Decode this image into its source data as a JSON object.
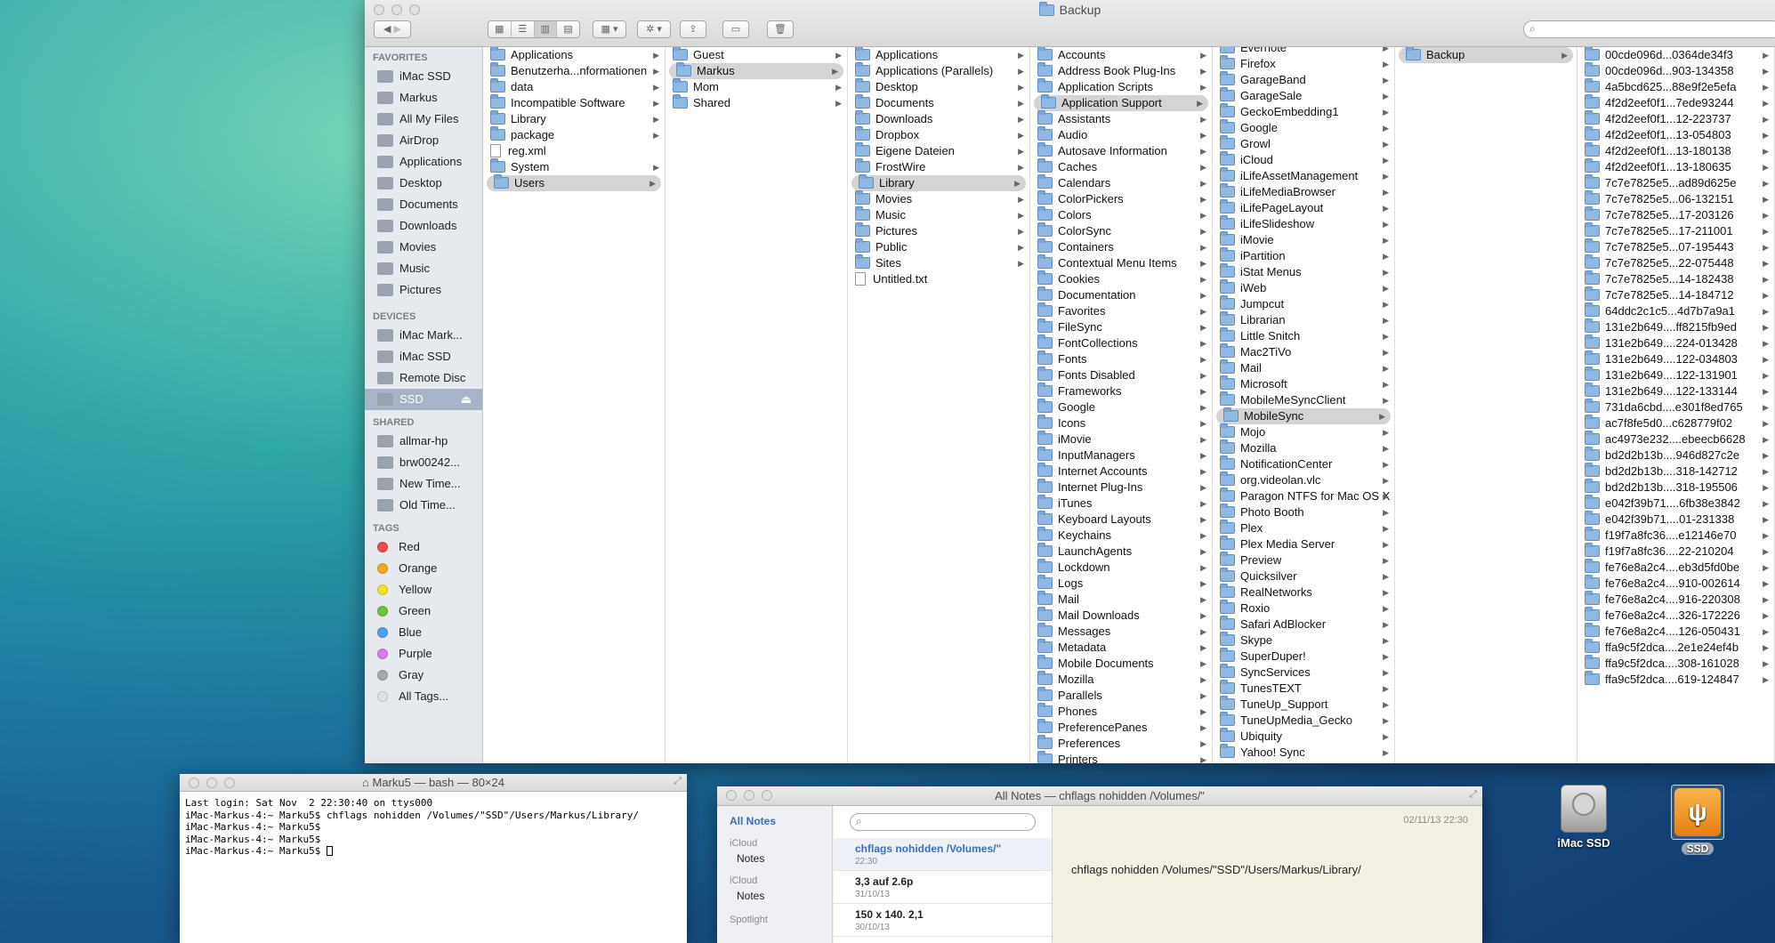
{
  "finder": {
    "title": "Backup",
    "sidebar": {
      "favorites_header": "FAVORITES",
      "favorites": [
        {
          "label": "iMac SSD",
          "icon": "hard-drive-icon"
        },
        {
          "label": "Markus",
          "icon": "home-icon"
        },
        {
          "label": "All My Files",
          "icon": "all-files-icon"
        },
        {
          "label": "AirDrop",
          "icon": "airdrop-icon"
        },
        {
          "label": "Applications",
          "icon": "applications-icon"
        },
        {
          "label": "Desktop",
          "icon": "desktop-icon"
        },
        {
          "label": "Documents",
          "icon": "documents-icon"
        },
        {
          "label": "Downloads",
          "icon": "downloads-icon"
        },
        {
          "label": "Movies",
          "icon": "movies-icon"
        },
        {
          "label": "Music",
          "icon": "music-icon"
        },
        {
          "label": "Pictures",
          "icon": "pictures-icon"
        }
      ],
      "devices_header": "DEVICES",
      "devices": [
        {
          "label": "iMac Mark...",
          "icon": "imac-icon"
        },
        {
          "label": "iMac SSD",
          "icon": "hard-drive-icon"
        },
        {
          "label": "Remote Disc",
          "icon": "disc-icon"
        },
        {
          "label": "SSD",
          "icon": "hard-drive-icon",
          "eject": "⏏"
        }
      ],
      "shared_header": "SHARED",
      "shared": [
        {
          "label": "allmar-hp",
          "icon": "computer-icon"
        },
        {
          "label": "brw00242...",
          "icon": "computer-icon"
        },
        {
          "label": "New Time...",
          "icon": "time-capsule-icon"
        },
        {
          "label": "Old Time...",
          "icon": "time-capsule-icon"
        }
      ],
      "tags_header": "TAGS",
      "tags": [
        {
          "label": "Red",
          "color": "#f24b4b"
        },
        {
          "label": "Orange",
          "color": "#f5a623"
        },
        {
          "label": "Yellow",
          "color": "#f5e023"
        },
        {
          "label": "Green",
          "color": "#70c23a"
        },
        {
          "label": "Blue",
          "color": "#4aa3f0"
        },
        {
          "label": "Purple",
          "color": "#d67ee8"
        },
        {
          "label": "Gray",
          "color": "#a8a8a8"
        },
        {
          "label": "All Tags...",
          "color": "#e0e0e0"
        }
      ]
    },
    "columns": [
      [
        {
          "n": "Applications",
          "t": "f",
          "a": 1
        },
        {
          "n": "Benutzerha...nformationen",
          "t": "f",
          "a": 1
        },
        {
          "n": "data",
          "t": "f",
          "a": 1
        },
        {
          "n": "Incompatible Software",
          "t": "f",
          "a": 1
        },
        {
          "n": "Library",
          "t": "f",
          "a": 1
        },
        {
          "n": "package",
          "t": "f",
          "a": 1
        },
        {
          "n": "reg.xml",
          "t": "d"
        },
        {
          "n": "System",
          "t": "f",
          "a": 1
        },
        {
          "n": "Users",
          "t": "f",
          "a": 1,
          "s": 1
        }
      ],
      [
        {
          "n": "Guest",
          "t": "f",
          "a": 1
        },
        {
          "n": "Markus",
          "t": "f",
          "a": 1,
          "s": 1
        },
        {
          "n": "Mom",
          "t": "f",
          "a": 1
        },
        {
          "n": "Shared",
          "t": "f",
          "a": 1
        }
      ],
      [
        {
          "n": "Applications",
          "t": "f",
          "a": 1
        },
        {
          "n": "Applications (Parallels)",
          "t": "f",
          "a": 1
        },
        {
          "n": "Desktop",
          "t": "f",
          "a": 1
        },
        {
          "n": "Documents",
          "t": "f",
          "a": 1
        },
        {
          "n": "Downloads",
          "t": "f",
          "a": 1
        },
        {
          "n": "Dropbox",
          "t": "f",
          "a": 1
        },
        {
          "n": "Eigene Dateien",
          "t": "f",
          "a": 1
        },
        {
          "n": "FrostWire",
          "t": "f",
          "a": 1
        },
        {
          "n": "Library",
          "t": "f",
          "a": 1,
          "s": 1
        },
        {
          "n": "Movies",
          "t": "f",
          "a": 1
        },
        {
          "n": "Music",
          "t": "f",
          "a": 1
        },
        {
          "n": "Pictures",
          "t": "f",
          "a": 1
        },
        {
          "n": "Public",
          "t": "f",
          "a": 1
        },
        {
          "n": "Sites",
          "t": "f",
          "a": 1
        },
        {
          "n": "Untitled.txt",
          "t": "d"
        }
      ],
      [
        {
          "n": "Accounts",
          "t": "f",
          "a": 1
        },
        {
          "n": "Address Book Plug-Ins",
          "t": "f",
          "a": 1
        },
        {
          "n": "Application Scripts",
          "t": "f",
          "a": 1
        },
        {
          "n": "Application Support",
          "t": "f",
          "a": 1,
          "s": 1
        },
        {
          "n": "Assistants",
          "t": "f",
          "a": 1
        },
        {
          "n": "Audio",
          "t": "f",
          "a": 1
        },
        {
          "n": "Autosave Information",
          "t": "f",
          "a": 1
        },
        {
          "n": "Caches",
          "t": "f",
          "a": 1
        },
        {
          "n": "Calendars",
          "t": "f",
          "a": 1
        },
        {
          "n": "ColorPickers",
          "t": "f",
          "a": 1
        },
        {
          "n": "Colors",
          "t": "f",
          "a": 1
        },
        {
          "n": "ColorSync",
          "t": "f",
          "a": 1
        },
        {
          "n": "Containers",
          "t": "f",
          "a": 1
        },
        {
          "n": "Contextual Menu Items",
          "t": "f",
          "a": 1
        },
        {
          "n": "Cookies",
          "t": "f",
          "a": 1
        },
        {
          "n": "Documentation",
          "t": "f",
          "a": 1
        },
        {
          "n": "Favorites",
          "t": "f",
          "a": 1
        },
        {
          "n": "FileSync",
          "t": "f",
          "a": 1
        },
        {
          "n": "FontCollections",
          "t": "f",
          "a": 1
        },
        {
          "n": "Fonts",
          "t": "f",
          "a": 1
        },
        {
          "n": "Fonts Disabled",
          "t": "f",
          "a": 1
        },
        {
          "n": "Frameworks",
          "t": "f",
          "a": 1
        },
        {
          "n": "Google",
          "t": "f",
          "a": 1
        },
        {
          "n": "Icons",
          "t": "f",
          "a": 1
        },
        {
          "n": "iMovie",
          "t": "f",
          "a": 1
        },
        {
          "n": "InputManagers",
          "t": "f",
          "a": 1
        },
        {
          "n": "Internet Accounts",
          "t": "f",
          "a": 1
        },
        {
          "n": "Internet Plug-Ins",
          "t": "f",
          "a": 1
        },
        {
          "n": "iTunes",
          "t": "f",
          "a": 1
        },
        {
          "n": "Keyboard Layouts",
          "t": "f",
          "a": 1
        },
        {
          "n": "Keychains",
          "t": "f",
          "a": 1
        },
        {
          "n": "LaunchAgents",
          "t": "f",
          "a": 1
        },
        {
          "n": "Lockdown",
          "t": "f",
          "a": 1
        },
        {
          "n": "Logs",
          "t": "f",
          "a": 1
        },
        {
          "n": "Mail",
          "t": "f",
          "a": 1
        },
        {
          "n": "Mail Downloads",
          "t": "f",
          "a": 1
        },
        {
          "n": "Messages",
          "t": "f",
          "a": 1
        },
        {
          "n": "Metadata",
          "t": "f",
          "a": 1
        },
        {
          "n": "Mobile Documents",
          "t": "f",
          "a": 1
        },
        {
          "n": "Mozilla",
          "t": "f",
          "a": 1
        },
        {
          "n": "Parallels",
          "t": "f",
          "a": 1
        },
        {
          "n": "Phones",
          "t": "f",
          "a": 1
        },
        {
          "n": "PreferencePanes",
          "t": "f",
          "a": 1
        },
        {
          "n": "Preferences",
          "t": "f",
          "a": 1
        },
        {
          "n": "Printers",
          "t": "f",
          "a": 1
        }
      ],
      [
        {
          "n": "Evernote",
          "t": "f",
          "a": 1
        },
        {
          "n": "Firefox",
          "t": "f",
          "a": 1
        },
        {
          "n": "GarageBand",
          "t": "f",
          "a": 1
        },
        {
          "n": "GarageSale",
          "t": "f",
          "a": 1
        },
        {
          "n": "GeckoEmbedding1",
          "t": "f",
          "a": 1
        },
        {
          "n": "Google",
          "t": "f",
          "a": 1
        },
        {
          "n": "Growl",
          "t": "f",
          "a": 1
        },
        {
          "n": "iCloud",
          "t": "f",
          "a": 1
        },
        {
          "n": "iLifeAssetManagement",
          "t": "f",
          "a": 1
        },
        {
          "n": "iLifeMediaBrowser",
          "t": "f",
          "a": 1
        },
        {
          "n": "iLifePageLayout",
          "t": "f",
          "a": 1
        },
        {
          "n": "iLifeSlideshow",
          "t": "f",
          "a": 1
        },
        {
          "n": "iMovie",
          "t": "f",
          "a": 1
        },
        {
          "n": "iPartition",
          "t": "f",
          "a": 1
        },
        {
          "n": "iStat Menus",
          "t": "f",
          "a": 1
        },
        {
          "n": "iWeb",
          "t": "f",
          "a": 1
        },
        {
          "n": "Jumpcut",
          "t": "f",
          "a": 1
        },
        {
          "n": "Librarian",
          "t": "f",
          "a": 1
        },
        {
          "n": "Little Snitch",
          "t": "f",
          "a": 1
        },
        {
          "n": "Mac2TiVo",
          "t": "f",
          "a": 1
        },
        {
          "n": "Mail",
          "t": "f",
          "a": 1
        },
        {
          "n": "Microsoft",
          "t": "f",
          "a": 1
        },
        {
          "n": "MobileMeSyncClient",
          "t": "f",
          "a": 1
        },
        {
          "n": "MobileSync",
          "t": "f",
          "a": 1,
          "s": 1
        },
        {
          "n": "Mojo",
          "t": "f",
          "a": 1
        },
        {
          "n": "Mozilla",
          "t": "f",
          "a": 1
        },
        {
          "n": "NotificationCenter",
          "t": "f",
          "a": 1
        },
        {
          "n": "org.videolan.vlc",
          "t": "f",
          "a": 1
        },
        {
          "n": "Paragon NTFS for Mac OS X",
          "t": "f",
          "a": 1
        },
        {
          "n": "Photo Booth",
          "t": "f",
          "a": 1
        },
        {
          "n": "Plex",
          "t": "f",
          "a": 1
        },
        {
          "n": "Plex Media Server",
          "t": "f",
          "a": 1
        },
        {
          "n": "Preview",
          "t": "f",
          "a": 1
        },
        {
          "n": "Quicksilver",
          "t": "f",
          "a": 1
        },
        {
          "n": "RealNetworks",
          "t": "f",
          "a": 1
        },
        {
          "n": "Roxio",
          "t": "f",
          "a": 1
        },
        {
          "n": "Safari AdBlocker",
          "t": "f",
          "a": 1
        },
        {
          "n": "Skype",
          "t": "f",
          "a": 1
        },
        {
          "n": "SuperDuper!",
          "t": "f",
          "a": 1
        },
        {
          "n": "SyncServices",
          "t": "f",
          "a": 1
        },
        {
          "n": "TunesTEXT",
          "t": "f",
          "a": 1
        },
        {
          "n": "TuneUp_Support",
          "t": "f",
          "a": 1
        },
        {
          "n": "TuneUpMedia_Gecko",
          "t": "f",
          "a": 1
        },
        {
          "n": "Ubiquity",
          "t": "f",
          "a": 1
        },
        {
          "n": "Yahoo! Sync",
          "t": "f",
          "a": 1
        }
      ],
      [
        {
          "n": "Backup",
          "t": "f",
          "a": 1,
          "s": 1
        }
      ],
      [
        {
          "n": "00cde096d...0364de34f3",
          "t": "f",
          "a": 1
        },
        {
          "n": "00cde096d...903-134358",
          "t": "f",
          "a": 1
        },
        {
          "n": "4a5bcd625...88e9f2e5efa",
          "t": "f",
          "a": 1
        },
        {
          "n": "4f2d2eef0f1...7ede93244",
          "t": "f",
          "a": 1
        },
        {
          "n": "4f2d2eef0f1...12-223737",
          "t": "f",
          "a": 1
        },
        {
          "n": "4f2d2eef0f1...13-054803",
          "t": "f",
          "a": 1
        },
        {
          "n": "4f2d2eef0f1...13-180138",
          "t": "f",
          "a": 1
        },
        {
          "n": "4f2d2eef0f1...13-180635",
          "t": "f",
          "a": 1
        },
        {
          "n": "7c7e7825e5...ad89d625e",
          "t": "f",
          "a": 1
        },
        {
          "n": "7c7e7825e5...06-132151",
          "t": "f",
          "a": 1
        },
        {
          "n": "7c7e7825e5...17-203126",
          "t": "f",
          "a": 1
        },
        {
          "n": "7c7e7825e5...17-211001",
          "t": "f",
          "a": 1
        },
        {
          "n": "7c7e7825e5...07-195443",
          "t": "f",
          "a": 1
        },
        {
          "n": "7c7e7825e5...22-075448",
          "t": "f",
          "a": 1
        },
        {
          "n": "7c7e7825e5...14-182438",
          "t": "f",
          "a": 1
        },
        {
          "n": "7c7e7825e5...14-184712",
          "t": "f",
          "a": 1
        },
        {
          "n": "64ddc2c1c5...4d7b7a9a1",
          "t": "f",
          "a": 1
        },
        {
          "n": "131e2b649....ff8215fb9ed",
          "t": "f",
          "a": 1
        },
        {
          "n": "131e2b649....224-013428",
          "t": "f",
          "a": 1
        },
        {
          "n": "131e2b649....122-034803",
          "t": "f",
          "a": 1
        },
        {
          "n": "131e2b649....122-131901",
          "t": "f",
          "a": 1
        },
        {
          "n": "131e2b649....122-133144",
          "t": "f",
          "a": 1
        },
        {
          "n": "731da6cbd....e301f8ed765",
          "t": "f",
          "a": 1
        },
        {
          "n": "ac7f8fe5d0...c628779f02",
          "t": "f",
          "a": 1
        },
        {
          "n": "ac4973e232....ebeecb6628",
          "t": "f",
          "a": 1
        },
        {
          "n": "bd2d2b13b....946d827c2e",
          "t": "f",
          "a": 1
        },
        {
          "n": "bd2d2b13b....318-142712",
          "t": "f",
          "a": 1
        },
        {
          "n": "bd2d2b13b....318-195506",
          "t": "f",
          "a": 1
        },
        {
          "n": "e042f39b71....6fb38e3842",
          "t": "f",
          "a": 1
        },
        {
          "n": "e042f39b71....01-231338",
          "t": "f",
          "a": 1
        },
        {
          "n": "f19f7a8fc36....e12146e70",
          "t": "f",
          "a": 1
        },
        {
          "n": "f19f7a8fc36....22-210204",
          "t": "f",
          "a": 1
        },
        {
          "n": "fe76e8a2c4....eb3d5fd0be",
          "t": "f",
          "a": 1
        },
        {
          "n": "fe76e8a2c4....910-002614",
          "t": "f",
          "a": 1
        },
        {
          "n": "fe76e8a2c4....916-220308",
          "t": "f",
          "a": 1
        },
        {
          "n": "fe76e8a2c4....326-172226",
          "t": "f",
          "a": 1
        },
        {
          "n": "fe76e8a2c4....126-050431",
          "t": "f",
          "a": 1
        },
        {
          "n": "ffa9c5f2dca....2e1e24ef4b",
          "t": "f",
          "a": 1
        },
        {
          "n": "ffa9c5f2dca....308-161028",
          "t": "f",
          "a": 1
        },
        {
          "n": "ffa9c5f2dca....619-124847",
          "t": "f",
          "a": 1
        }
      ]
    ],
    "search": {
      "placeholder": ""
    }
  },
  "terminal": {
    "title": "Marku5 — bash — 80×24",
    "lines": [
      "Last login: Sat Nov  2 22:30:40 on ttys000",
      "iMac-Markus-4:~ Marku5$ chflags nohidden /Volumes/\"SSD\"/Users/Markus/Library/",
      "iMac-Markus-4:~ Marku5$",
      "iMac-Markus-4:~ Marku5$",
      "iMac-Markus-4:~ Marku5$ "
    ]
  },
  "notes": {
    "title": "All Notes — chflags nohidden /Volumes/\"",
    "sidebar": {
      "all_notes": "All Notes",
      "groups": [
        {
          "account": "iCloud",
          "folder": "Notes"
        },
        {
          "account": "iCloud",
          "folder": "Notes"
        }
      ],
      "cut_label": "Spotlight"
    },
    "list": [
      {
        "title": "chflags nohidden /Volumes/\"",
        "date": "22:30"
      },
      {
        "title": "3,3 auf 2.6p",
        "date": "31/10/13"
      },
      {
        "title": "150 x 140.  2,1",
        "date": "30/10/13"
      }
    ],
    "note": {
      "date": "02/11/13 22:30",
      "body": "chflags nohidden /Volumes/\"SSD\"/Users/Markus/Library/"
    },
    "search": {
      "placeholder": ""
    }
  },
  "desktop": {
    "icons": [
      {
        "label": "iMac SSD"
      },
      {
        "label": "SSD"
      }
    ]
  }
}
